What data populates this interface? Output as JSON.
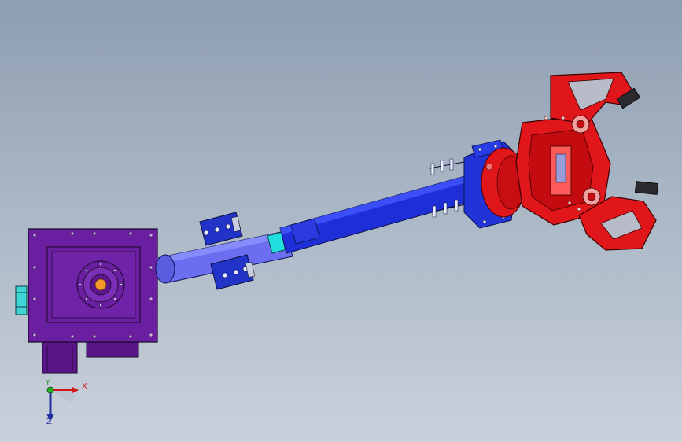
{
  "viewport": {
    "background_top": "#8e9db1",
    "background_bottom": "#c9d1db"
  },
  "model_colors": {
    "base": "#6a1fa0",
    "arm_light": "#6b6ef0",
    "arm_dark": "#1f2fd8",
    "accent_cyan": "#22e0e0",
    "gripper": "#e0161a"
  },
  "triad": {
    "x_label": "X",
    "y_label": "Y",
    "z_label": "Z"
  }
}
